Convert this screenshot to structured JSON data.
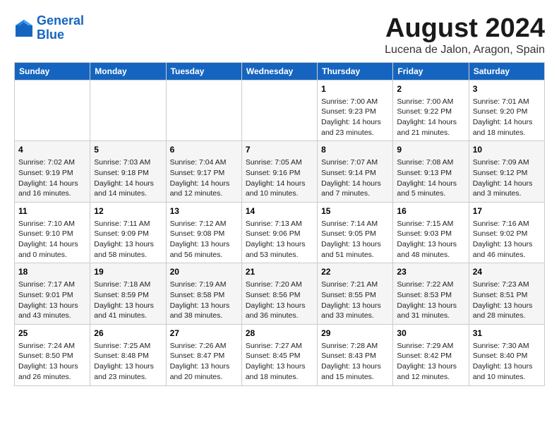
{
  "header": {
    "logo_line1": "General",
    "logo_line2": "Blue",
    "title": "August 2024",
    "subtitle": "Lucena de Jalon, Aragon, Spain"
  },
  "weekdays": [
    "Sunday",
    "Monday",
    "Tuesday",
    "Wednesday",
    "Thursday",
    "Friday",
    "Saturday"
  ],
  "weeks": [
    [
      {
        "date": "",
        "content": ""
      },
      {
        "date": "",
        "content": ""
      },
      {
        "date": "",
        "content": ""
      },
      {
        "date": "",
        "content": ""
      },
      {
        "date": "1",
        "content": "Sunrise: 7:00 AM\nSunset: 9:23 PM\nDaylight: 14 hours\nand 23 minutes."
      },
      {
        "date": "2",
        "content": "Sunrise: 7:00 AM\nSunset: 9:22 PM\nDaylight: 14 hours\nand 21 minutes."
      },
      {
        "date": "3",
        "content": "Sunrise: 7:01 AM\nSunset: 9:20 PM\nDaylight: 14 hours\nand 18 minutes."
      }
    ],
    [
      {
        "date": "4",
        "content": "Sunrise: 7:02 AM\nSunset: 9:19 PM\nDaylight: 14 hours\nand 16 minutes."
      },
      {
        "date": "5",
        "content": "Sunrise: 7:03 AM\nSunset: 9:18 PM\nDaylight: 14 hours\nand 14 minutes."
      },
      {
        "date": "6",
        "content": "Sunrise: 7:04 AM\nSunset: 9:17 PM\nDaylight: 14 hours\nand 12 minutes."
      },
      {
        "date": "7",
        "content": "Sunrise: 7:05 AM\nSunset: 9:16 PM\nDaylight: 14 hours\nand 10 minutes."
      },
      {
        "date": "8",
        "content": "Sunrise: 7:07 AM\nSunset: 9:14 PM\nDaylight: 14 hours\nand 7 minutes."
      },
      {
        "date": "9",
        "content": "Sunrise: 7:08 AM\nSunset: 9:13 PM\nDaylight: 14 hours\nand 5 minutes."
      },
      {
        "date": "10",
        "content": "Sunrise: 7:09 AM\nSunset: 9:12 PM\nDaylight: 14 hours\nand 3 minutes."
      }
    ],
    [
      {
        "date": "11",
        "content": "Sunrise: 7:10 AM\nSunset: 9:10 PM\nDaylight: 14 hours\nand 0 minutes."
      },
      {
        "date": "12",
        "content": "Sunrise: 7:11 AM\nSunset: 9:09 PM\nDaylight: 13 hours\nand 58 minutes."
      },
      {
        "date": "13",
        "content": "Sunrise: 7:12 AM\nSunset: 9:08 PM\nDaylight: 13 hours\nand 56 minutes."
      },
      {
        "date": "14",
        "content": "Sunrise: 7:13 AM\nSunset: 9:06 PM\nDaylight: 13 hours\nand 53 minutes."
      },
      {
        "date": "15",
        "content": "Sunrise: 7:14 AM\nSunset: 9:05 PM\nDaylight: 13 hours\nand 51 minutes."
      },
      {
        "date": "16",
        "content": "Sunrise: 7:15 AM\nSunset: 9:03 PM\nDaylight: 13 hours\nand 48 minutes."
      },
      {
        "date": "17",
        "content": "Sunrise: 7:16 AM\nSunset: 9:02 PM\nDaylight: 13 hours\nand 46 minutes."
      }
    ],
    [
      {
        "date": "18",
        "content": "Sunrise: 7:17 AM\nSunset: 9:01 PM\nDaylight: 13 hours\nand 43 minutes."
      },
      {
        "date": "19",
        "content": "Sunrise: 7:18 AM\nSunset: 8:59 PM\nDaylight: 13 hours\nand 41 minutes."
      },
      {
        "date": "20",
        "content": "Sunrise: 7:19 AM\nSunset: 8:58 PM\nDaylight: 13 hours\nand 38 minutes."
      },
      {
        "date": "21",
        "content": "Sunrise: 7:20 AM\nSunset: 8:56 PM\nDaylight: 13 hours\nand 36 minutes."
      },
      {
        "date": "22",
        "content": "Sunrise: 7:21 AM\nSunset: 8:55 PM\nDaylight: 13 hours\nand 33 minutes."
      },
      {
        "date": "23",
        "content": "Sunrise: 7:22 AM\nSunset: 8:53 PM\nDaylight: 13 hours\nand 31 minutes."
      },
      {
        "date": "24",
        "content": "Sunrise: 7:23 AM\nSunset: 8:51 PM\nDaylight: 13 hours\nand 28 minutes."
      }
    ],
    [
      {
        "date": "25",
        "content": "Sunrise: 7:24 AM\nSunset: 8:50 PM\nDaylight: 13 hours\nand 26 minutes."
      },
      {
        "date": "26",
        "content": "Sunrise: 7:25 AM\nSunset: 8:48 PM\nDaylight: 13 hours\nand 23 minutes."
      },
      {
        "date": "27",
        "content": "Sunrise: 7:26 AM\nSunset: 8:47 PM\nDaylight: 13 hours\nand 20 minutes."
      },
      {
        "date": "28",
        "content": "Sunrise: 7:27 AM\nSunset: 8:45 PM\nDaylight: 13 hours\nand 18 minutes."
      },
      {
        "date": "29",
        "content": "Sunrise: 7:28 AM\nSunset: 8:43 PM\nDaylight: 13 hours\nand 15 minutes."
      },
      {
        "date": "30",
        "content": "Sunrise: 7:29 AM\nSunset: 8:42 PM\nDaylight: 13 hours\nand 12 minutes."
      },
      {
        "date": "31",
        "content": "Sunrise: 7:30 AM\nSunset: 8:40 PM\nDaylight: 13 hours\nand 10 minutes."
      }
    ]
  ]
}
